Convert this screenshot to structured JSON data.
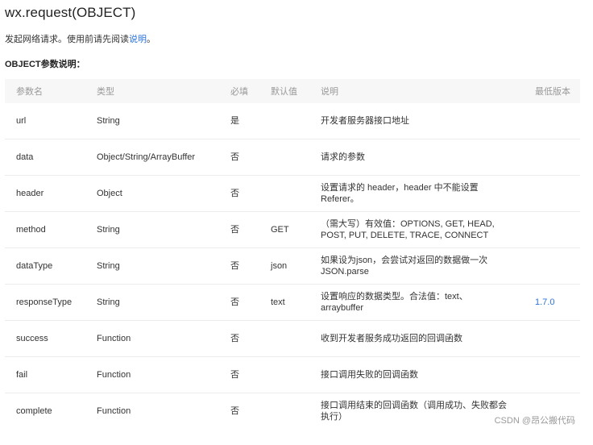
{
  "doc": {
    "title": "wx.request(OBJECT)",
    "intro_text": "发起网络请求。使用前请先阅读",
    "intro_link": "说明",
    "intro_end": "。",
    "section_title": "OBJECT参数说明："
  },
  "table": {
    "headers": {
      "name": "参数名",
      "type": "类型",
      "required": "必填",
      "default": "默认值",
      "description": "说明",
      "min_version": "最低版本"
    },
    "rows": [
      {
        "name": "url",
        "type": "String",
        "required": "是",
        "default": "",
        "description": "开发者服务器接口地址",
        "min_version": ""
      },
      {
        "name": "data",
        "type": "Object/String/ArrayBuffer",
        "required": "否",
        "default": "",
        "description": "请求的参数",
        "min_version": ""
      },
      {
        "name": "header",
        "type": "Object",
        "required": "否",
        "default": "",
        "description": "设置请求的 header，header 中不能设置 Referer。",
        "min_version": ""
      },
      {
        "name": "method",
        "type": "String",
        "required": "否",
        "default": "GET",
        "description": "（需大写）有效值：OPTIONS, GET, HEAD, POST, PUT, DELETE, TRACE, CONNECT",
        "min_version": ""
      },
      {
        "name": "dataType",
        "type": "String",
        "required": "否",
        "default": "json",
        "description": "如果设为json，会尝试对返回的数据做一次 JSON.parse",
        "min_version": ""
      },
      {
        "name": "responseType",
        "type": "String",
        "required": "否",
        "default": "text",
        "description": "设置响应的数据类型。合法值：text、arraybuffer",
        "min_version": "1.7.0"
      },
      {
        "name": "success",
        "type": "Function",
        "required": "否",
        "default": "",
        "description": "收到开发者服务成功返回的回调函数",
        "min_version": ""
      },
      {
        "name": "fail",
        "type": "Function",
        "required": "否",
        "default": "",
        "description": "接口调用失败的回调函数",
        "min_version": ""
      },
      {
        "name": "complete",
        "type": "Function",
        "required": "否",
        "default": "",
        "description": "接口调用结束的回调函数（调用成功、失败都会执行）",
        "min_version": ""
      }
    ]
  },
  "watermark": "CSDN @昂公搬代码"
}
